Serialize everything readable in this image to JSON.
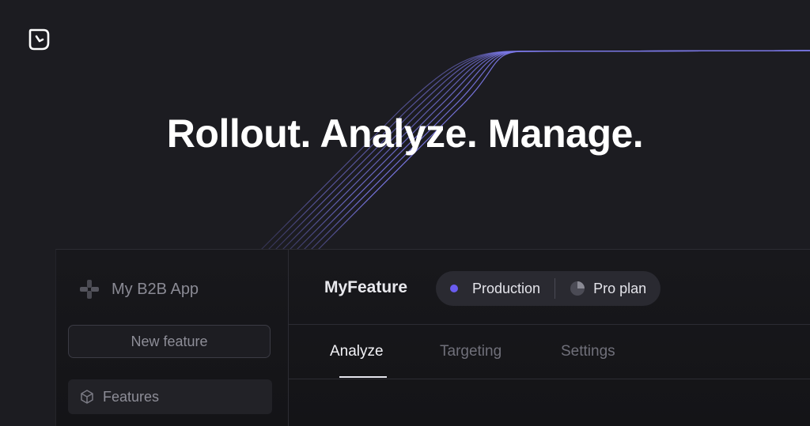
{
  "hero": {
    "title": "Rollout. Analyze. Manage."
  },
  "sidebar": {
    "app_name": "My B2B App",
    "new_feature_label": "New feature",
    "items": [
      {
        "label": "Features",
        "icon": "cube-icon"
      }
    ]
  },
  "main": {
    "feature_title": "MyFeature",
    "environment": {
      "label": "Production",
      "color": "#6a5cf0"
    },
    "plan": {
      "label": "Pro plan"
    },
    "tabs": [
      {
        "label": "Analyze",
        "active": true
      },
      {
        "label": "Targeting",
        "active": false
      },
      {
        "label": "Settings",
        "active": false
      }
    ]
  },
  "colors": {
    "background": "#1c1c21",
    "accent_lines": "#7b78e6",
    "pill_background": "#2a2a31"
  }
}
